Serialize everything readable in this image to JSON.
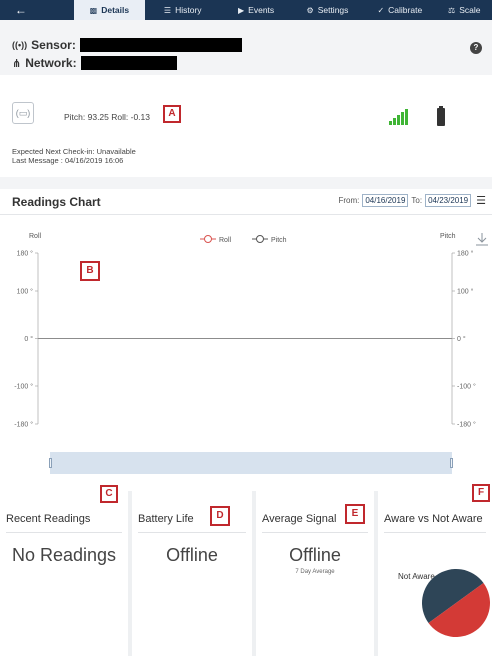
{
  "nav": {
    "back_icon": "arrow-left-icon",
    "tabs": [
      {
        "label": "Details",
        "icon": "bar-chart-icon",
        "active": true
      },
      {
        "label": "History",
        "icon": "list-icon"
      },
      {
        "label": "Events",
        "icon": "megaphone-icon"
      },
      {
        "label": "Settings",
        "icon": "gear-icon"
      },
      {
        "label": "Calibrate",
        "icon": "wrench-icon"
      },
      {
        "label": "Scale",
        "icon": "scale-icon"
      }
    ]
  },
  "sensor": {
    "sensor_label": "Sensor:",
    "network_label": "Network:",
    "help_label": "?"
  },
  "status": {
    "reading": "Pitch: 93.25 Roll: -0.13",
    "next_checkin": "Expected Next Check-in: Unavailable",
    "last_message": "Last Message : 04/16/2019 16:06",
    "signal_bars": 5,
    "signal_color": "#3fb535"
  },
  "chart_section": {
    "title": "Readings Chart",
    "from_label": "From:",
    "from_value": "04/16/2019",
    "to_label": "To:",
    "to_value": "04/23/2019"
  },
  "chart_data": {
    "type": "line",
    "left_axis_label": "Roll",
    "right_axis_label": "Pitch",
    "legend": [
      "Roll",
      "Pitch"
    ],
    "legend_placement": "top-center",
    "series": [
      {
        "name": "Roll",
        "color": "#d9534f",
        "values": []
      },
      {
        "name": "Pitch",
        "color": "#555555",
        "values": []
      }
    ],
    "ylim": [
      -180,
      180
    ],
    "left_ticks": [
      "180 °",
      "100 °",
      "0 °",
      "-100 °",
      "-180 °"
    ],
    "right_ticks": [
      "180 °",
      "100 °",
      "0 °",
      "-100 °",
      "-180 °"
    ],
    "tick_values": [
      180,
      100,
      0,
      -100,
      -180
    ]
  },
  "annotations": [
    "A",
    "B",
    "C",
    "D",
    "E",
    "F"
  ],
  "tiles": {
    "recent": {
      "title": "Recent Readings",
      "value": "No Readings"
    },
    "battery": {
      "title": "Battery Life",
      "value": "Offline"
    },
    "signal": {
      "title": "Average Signal",
      "value": "Offline",
      "sub": "7 Day Average"
    },
    "aware": {
      "title": "Aware vs Not Aware",
      "label": "Not Aware",
      "colors": [
        "#2e4557",
        "#d33a36"
      ]
    }
  }
}
